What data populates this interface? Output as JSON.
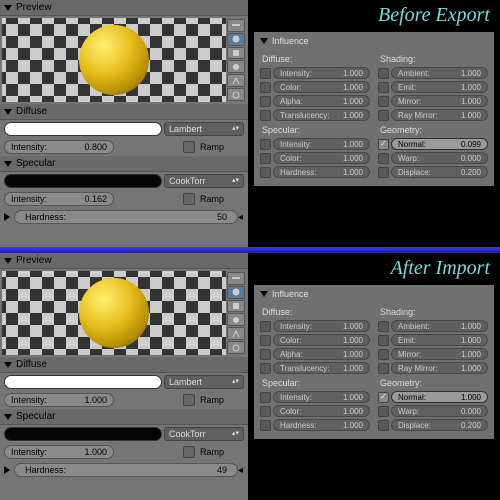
{
  "titles": {
    "before": "Before Export",
    "after": "After Import"
  },
  "panels": {
    "preview": "Preview",
    "diffuse": "Diffuse",
    "specular": "Specular",
    "influence": "Influence"
  },
  "before": {
    "diffuse": {
      "intensity_label": "Intensity:",
      "intensity": "0.800",
      "shader": "Lambert",
      "ramp": "Ramp"
    },
    "specular": {
      "intensity_label": "Intensity:",
      "intensity": "0.162",
      "shader": "CookTorr",
      "ramp": "Ramp",
      "hardness_label": "Hardness:",
      "hardness": "50"
    },
    "influence": {
      "diffuse_label": "Diffuse:",
      "shading_label": "Shading:",
      "specular_label": "Specular:",
      "geometry_label": "Geometry:",
      "diffuse": [
        {
          "label": "Intensity:",
          "value": "1.000",
          "on": false
        },
        {
          "label": "Color:",
          "value": "1.000",
          "on": false
        },
        {
          "label": "Alpha:",
          "value": "1.000",
          "on": false
        },
        {
          "label": "Translucency:",
          "value": "1.000",
          "on": false
        }
      ],
      "shading": [
        {
          "label": "Ambient:",
          "value": "1.000",
          "on": false
        },
        {
          "label": "Emit:",
          "value": "1.000",
          "on": false
        },
        {
          "label": "Mirror:",
          "value": "1.000",
          "on": false
        },
        {
          "label": "Ray Mirror:",
          "value": "1.000",
          "on": false
        }
      ],
      "specular": [
        {
          "label": "Intensity:",
          "value": "1.000",
          "on": false
        },
        {
          "label": "Color:",
          "value": "1.000",
          "on": false
        },
        {
          "label": "Hardness:",
          "value": "1.000",
          "on": false
        }
      ],
      "geometry": [
        {
          "label": "Normal:",
          "value": "0.099",
          "on": true
        },
        {
          "label": "Warp:",
          "value": "0.000",
          "on": false
        },
        {
          "label": "Displace:",
          "value": "0.200",
          "on": false
        }
      ]
    }
  },
  "after": {
    "diffuse": {
      "intensity_label": "Intensity:",
      "intensity": "1.000",
      "shader": "Lambert",
      "ramp": "Ramp"
    },
    "specular": {
      "intensity_label": "Intensity:",
      "intensity": "1.000",
      "shader": "CookTorr",
      "ramp": "Ramp",
      "hardness_label": "Hardness:",
      "hardness": "49"
    },
    "influence": {
      "diffuse_label": "Diffuse:",
      "shading_label": "Shading:",
      "specular_label": "Specular:",
      "geometry_label": "Geometry:",
      "diffuse": [
        {
          "label": "Intensity:",
          "value": "1.000",
          "on": false
        },
        {
          "label": "Color:",
          "value": "1.000",
          "on": false
        },
        {
          "label": "Alpha:",
          "value": "1.000",
          "on": false
        },
        {
          "label": "Translucency:",
          "value": "1.000",
          "on": false
        }
      ],
      "shading": [
        {
          "label": "Ambient:",
          "value": "1.000",
          "on": false
        },
        {
          "label": "Emit:",
          "value": "1.000",
          "on": false
        },
        {
          "label": "Mirror:",
          "value": "1.000",
          "on": false
        },
        {
          "label": "Ray Mirror:",
          "value": "1.000",
          "on": false
        }
      ],
      "specular": [
        {
          "label": "Intensity:",
          "value": "1.000",
          "on": false
        },
        {
          "label": "Color:",
          "value": "1.000",
          "on": false
        },
        {
          "label": "Hardness:",
          "value": "1.000",
          "on": false
        }
      ],
      "geometry": [
        {
          "label": "Normal:",
          "value": "1.000",
          "on": true
        },
        {
          "label": "Warp:",
          "value": "0.000",
          "on": false
        },
        {
          "label": "Displace:",
          "value": "0.200",
          "on": false
        }
      ]
    }
  },
  "preview_icons": [
    "flat-icon",
    "sphere-icon",
    "cube-icon",
    "monkey-icon",
    "hair-icon",
    "sky-icon"
  ]
}
